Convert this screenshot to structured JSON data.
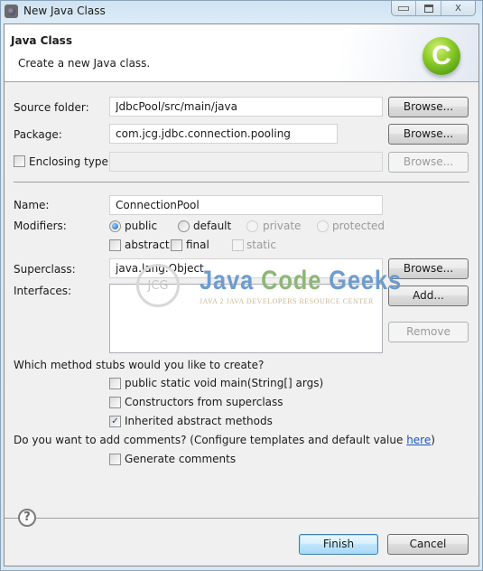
{
  "window": {
    "title": "New Java Class",
    "controls": {
      "minimize": "",
      "maximize": "",
      "close": "X"
    }
  },
  "header": {
    "title": "Java Class",
    "description": "Create a new Java class.",
    "logo_letter": "C"
  },
  "form": {
    "source_folder": {
      "label": "Source folder:",
      "value": "JdbcPool/src/main/java",
      "browse": "Browse..."
    },
    "package": {
      "label": "Package:",
      "value": "com.jcg.jdbc.connection.pooling",
      "browse": "Browse..."
    },
    "enclosing_type": {
      "label": "Enclosing type:",
      "checked": false,
      "value": "",
      "browse": "Browse..."
    },
    "name": {
      "label": "Name:",
      "value": "ConnectionPool"
    },
    "modifiers": {
      "label": "Modifiers:",
      "access": [
        {
          "label": "public",
          "selected": true,
          "enabled": true
        },
        {
          "label": "default",
          "selected": false,
          "enabled": true
        },
        {
          "label": "private",
          "selected": false,
          "enabled": false
        },
        {
          "label": "protected",
          "selected": false,
          "enabled": false
        }
      ],
      "flags": [
        {
          "label": "abstract",
          "checked": false,
          "enabled": true
        },
        {
          "label": "final",
          "checked": false,
          "enabled": true
        },
        {
          "label": "static",
          "checked": false,
          "enabled": false
        }
      ]
    },
    "superclass": {
      "label": "Superclass:",
      "value": "java.lang.Object",
      "browse": "Browse..."
    },
    "interfaces": {
      "label": "Interfaces:",
      "items": [],
      "add": "Add...",
      "remove": "Remove"
    },
    "stubs": {
      "question": "Which method stubs would you like to create?",
      "options": [
        {
          "label": "public static void main(String[] args)",
          "checked": false
        },
        {
          "label": "Constructors from superclass",
          "checked": false
        },
        {
          "label": "Inherited abstract methods",
          "checked": true
        }
      ]
    },
    "comments": {
      "question_prefix": "Do you want to add comments? (Configure templates and default value ",
      "link": "here",
      "question_suffix": ")",
      "option": {
        "label": "Generate comments",
        "checked": false
      }
    }
  },
  "watermark": {
    "circle_text": "JCG",
    "word1": "Java",
    "word2": "Code",
    "word3": "Geeks",
    "subtitle": "JAVA 2 JAVA DEVELOPERS RESOURCE CENTER"
  },
  "footer": {
    "help": "?",
    "finish": "Finish",
    "cancel": "Cancel"
  }
}
